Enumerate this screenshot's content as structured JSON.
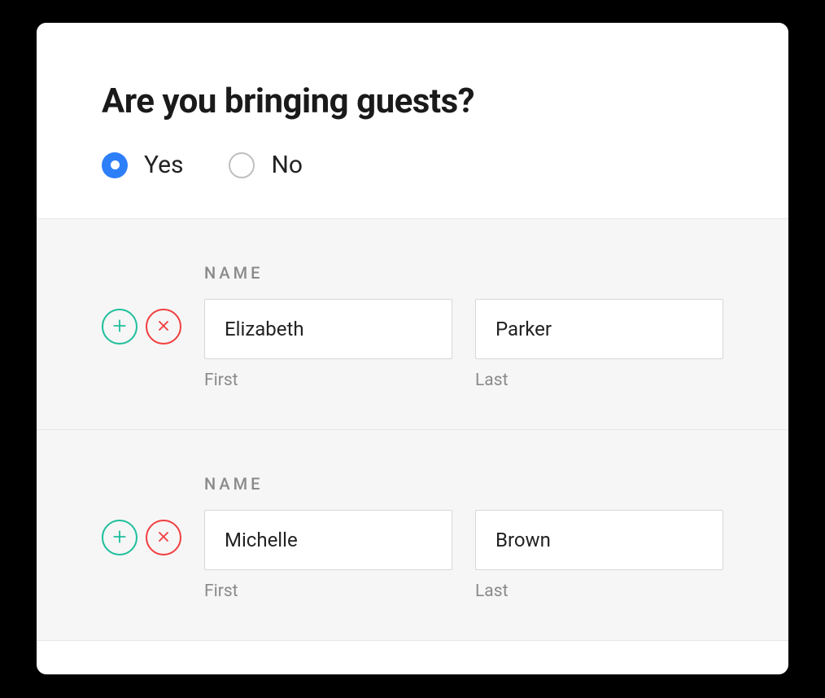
{
  "question": {
    "title": "Are you bringing guests?",
    "options": {
      "yes": "Yes",
      "no": "No"
    },
    "selected": "yes"
  },
  "guest_form": {
    "name_label": "NAME",
    "first_label": "First",
    "last_label": "Last"
  },
  "guests": [
    {
      "first": "Elizabeth",
      "last": "Parker"
    },
    {
      "first": "Michelle",
      "last": "Brown"
    }
  ],
  "colors": {
    "accent": "#2d7ff9",
    "add": "#1fbf9c",
    "remove": "#f03e3e"
  }
}
